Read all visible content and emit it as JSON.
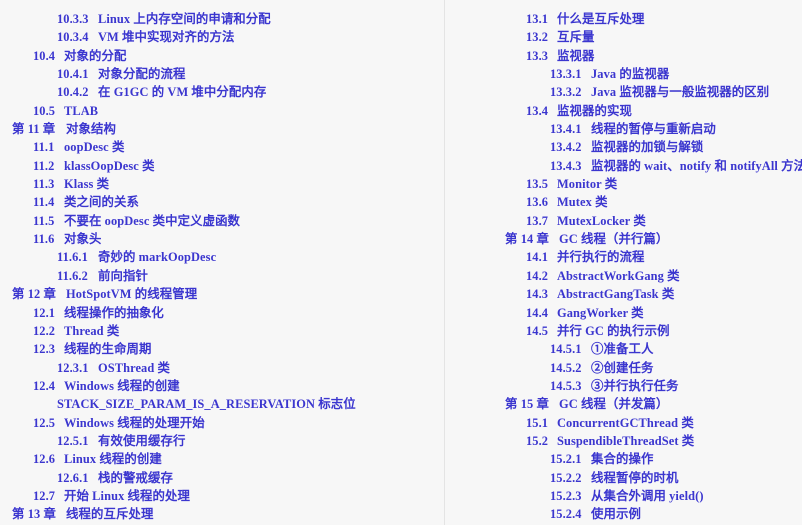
{
  "page": {
    "type": "table-of-contents",
    "background_color": "#f7f7f7",
    "text_color": "#3b36cf",
    "divider_color": "#e4e4e4"
  },
  "columns": [
    {
      "name": "left-column",
      "entries": [
        {
          "level": 3,
          "number": "10.3.3",
          "title": "Linux 上内存空间的申请和分配"
        },
        {
          "level": 3,
          "number": "10.3.4",
          "title": "VM 堆中实现对齐的方法"
        },
        {
          "level": 2,
          "number": "10.4",
          "title": "对象的分配"
        },
        {
          "level": 3,
          "number": "10.4.1",
          "title": "对象分配的流程"
        },
        {
          "level": 3,
          "number": "10.4.2",
          "title": "在 G1GC 的 VM 堆中分配内存"
        },
        {
          "level": 2,
          "number": "10.5",
          "title": "TLAB"
        },
        {
          "level": 1,
          "number": "第 11 章",
          "title": "对象结构"
        },
        {
          "level": 2,
          "number": "11.1",
          "title": "oopDesc 类"
        },
        {
          "level": 2,
          "number": "11.2",
          "title": "klassOopDesc 类"
        },
        {
          "level": 2,
          "number": "11.3",
          "title": "Klass 类"
        },
        {
          "level": 2,
          "number": "11.4",
          "title": "类之间的关系"
        },
        {
          "level": 2,
          "number": "11.5",
          "title": "不要在 oopDesc 类中定义虚函数"
        },
        {
          "level": 2,
          "number": "11.6",
          "title": "对象头"
        },
        {
          "level": 3,
          "number": "11.6.1",
          "title": "奇妙的 markOopDesc"
        },
        {
          "level": 3,
          "number": "11.6.2",
          "title": "前向指针"
        },
        {
          "level": 1,
          "number": "第 12 章",
          "title": "HotSpotVM 的线程管理"
        },
        {
          "level": 2,
          "number": "12.1",
          "title": "线程操作的抽象化"
        },
        {
          "level": 2,
          "number": "12.2",
          "title": "Thread 类"
        },
        {
          "level": 2,
          "number": "12.3",
          "title": "线程的生命周期"
        },
        {
          "level": 3,
          "number": "12.3.1",
          "title": "OSThread 类"
        },
        {
          "level": 2,
          "number": "12.4",
          "title": "Windows 线程的创建"
        },
        {
          "level": 0,
          "number": "",
          "title": "STACK_SIZE_PARAM_IS_A_RESERVATION 标志位"
        },
        {
          "level": 2,
          "number": "12.5",
          "title": "Windows 线程的处理开始"
        },
        {
          "level": 3,
          "number": "12.5.1",
          "title": "有效使用缓存行"
        },
        {
          "level": 2,
          "number": "12.6",
          "title": "Linux 线程的创建"
        },
        {
          "level": 3,
          "number": "12.6.1",
          "title": "栈的警戒缓存"
        },
        {
          "level": 2,
          "number": "12.7",
          "title": "开始 Linux 线程的处理"
        },
        {
          "level": 1,
          "number": "第 13 章",
          "title": "线程的互斥处理"
        }
      ]
    },
    {
      "name": "right-column",
      "entries": [
        {
          "level": 2,
          "number": "13.1",
          "title": "什么是互斥处理"
        },
        {
          "level": 2,
          "number": "13.2",
          "title": "互斥量"
        },
        {
          "level": 2,
          "number": "13.3",
          "title": "监视器"
        },
        {
          "level": 3,
          "number": "13.3.1",
          "title": "Java 的监视器"
        },
        {
          "level": 3,
          "number": "13.3.2",
          "title": "Java 监视器与一般监视器的区别"
        },
        {
          "level": 2,
          "number": "13.4",
          "title": "监视器的实现"
        },
        {
          "level": 3,
          "number": "13.4.1",
          "title": "线程的暂停与重新启动"
        },
        {
          "level": 3,
          "number": "13.4.2",
          "title": "监视器的加锁与解锁"
        },
        {
          "level": 3,
          "number": "13.4.3",
          "title": "监视器的 wait、notify 和 notifyAll 方法"
        },
        {
          "level": 2,
          "number": "13.5",
          "title": "Monitor 类"
        },
        {
          "level": 2,
          "number": "13.6",
          "title": "Mutex 类"
        },
        {
          "level": 2,
          "number": "13.7",
          "title": "MutexLocker 类"
        },
        {
          "level": 1,
          "number": "第 14 章",
          "title": "GC 线程（并行篇）"
        },
        {
          "level": 2,
          "number": "14.1",
          "title": "并行执行的流程"
        },
        {
          "level": 2,
          "number": "14.2",
          "title": "AbstractWorkGang 类"
        },
        {
          "level": 2,
          "number": "14.3",
          "title": "AbstractGangTask 类"
        },
        {
          "level": 2,
          "number": "14.4",
          "title": "GangWorker 类"
        },
        {
          "level": 2,
          "number": "14.5",
          "title": "并行 GC 的执行示例"
        },
        {
          "level": 3,
          "number": "14.5.1",
          "title": "①准备工人"
        },
        {
          "level": 3,
          "number": "14.5.2",
          "title": "②创建任务"
        },
        {
          "level": 3,
          "number": "14.5.3",
          "title": "③并行执行任务"
        },
        {
          "level": 1,
          "number": "第 15 章",
          "title": "GC 线程（并发篇）"
        },
        {
          "level": 2,
          "number": "15.1",
          "title": "ConcurrentGCThread 类"
        },
        {
          "level": 2,
          "number": "15.2",
          "title": "SuspendibleThreadSet 类"
        },
        {
          "level": 3,
          "number": "15.2.1",
          "title": "集合的操作"
        },
        {
          "level": 3,
          "number": "15.2.2",
          "title": "线程暂停的时机"
        },
        {
          "level": 3,
          "number": "15.2.3",
          "title": "从集合外调用 yield()"
        },
        {
          "level": 3,
          "number": "15.2.4",
          "title": "使用示例"
        }
      ]
    }
  ]
}
